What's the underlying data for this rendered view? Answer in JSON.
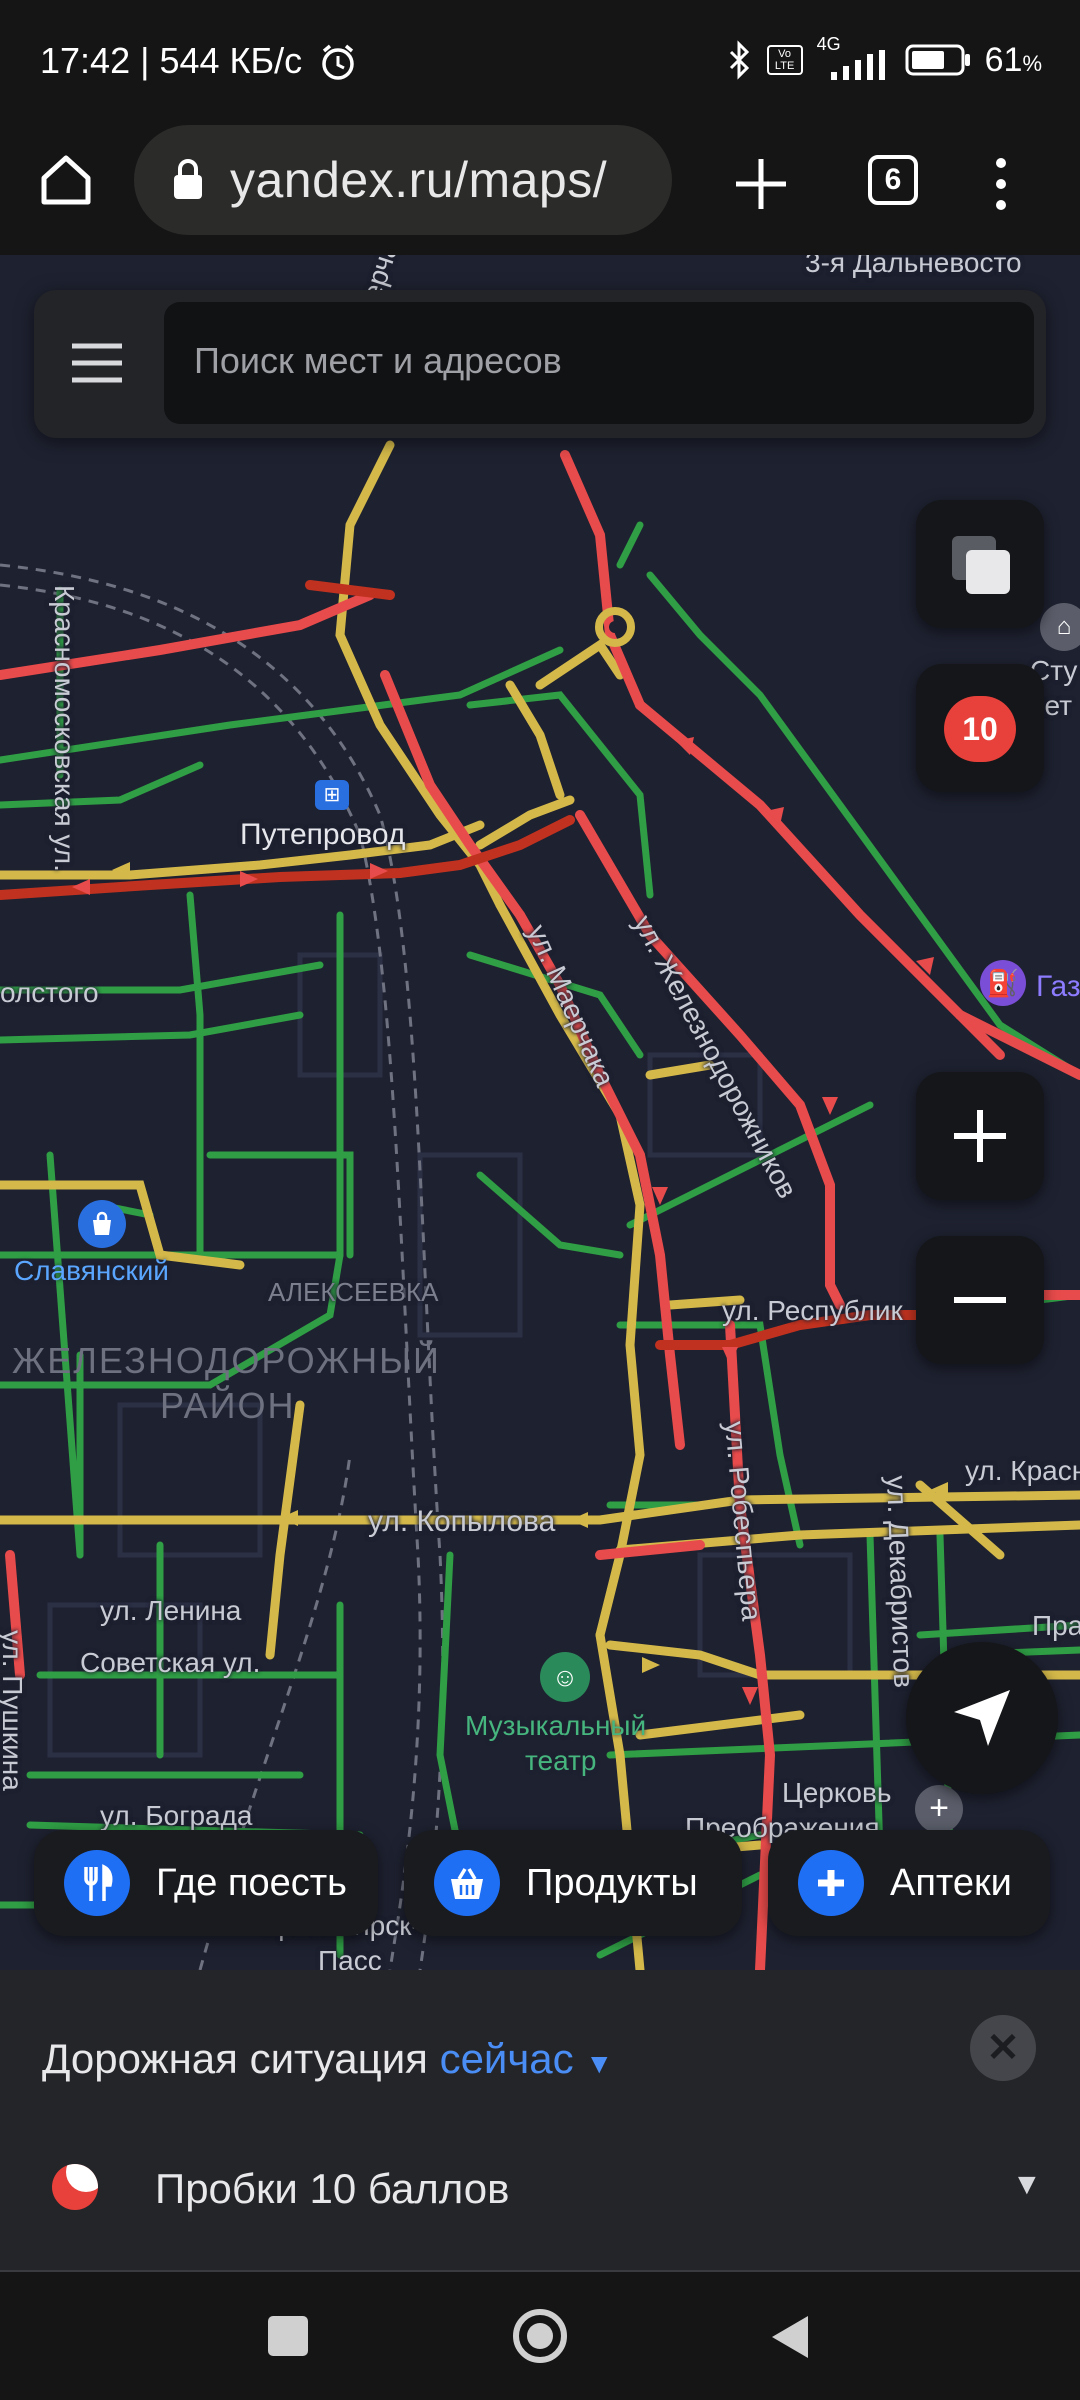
{
  "status_bar": {
    "time": "17:42 | 544 КБ/с",
    "signal_type": "4G",
    "volte": "Vo LTE",
    "battery": "61",
    "battery_unit": "%",
    "icons": [
      "alarm-icon",
      "bluetooth-icon",
      "signal-icon",
      "battery-icon"
    ]
  },
  "browser": {
    "url": "yandex.ru/maps/",
    "tab_count": "6",
    "icons": [
      "home-icon",
      "lock-icon",
      "new-tab-icon",
      "tabs-icon",
      "more-icon"
    ]
  },
  "search": {
    "placeholder": "Поиск мест и адресов"
  },
  "map_controls": {
    "traffic_score": "10"
  },
  "map_labels": {
    "street_top": "3-я Дальневосто",
    "maerchaka_1": "ул. Маерчака",
    "maerchaka_2": "ул. Маерчака",
    "krasnomoskovskaya": "Красномосковская ул.",
    "puteprovod": "Путепровод",
    "zheleznodorozhnikov": "ул. Железнодорожников",
    "tolstogo": "олстого",
    "gas_station": "Газ",
    "slavyansky": "Славянский",
    "alekseevka": "АЛЕКСЕЕВКА",
    "district_1": "ЖЕЛЕЗНОДОРОЖНЫЙ",
    "district_2": "РАЙОН",
    "respubliki": "ул. Республик",
    "robespera": "ул. Робеспьера",
    "kopylova": "ул. Копылова",
    "krasn": "ул. Красн",
    "dekabristov": "ул. Декабристов",
    "lenina": "ул. Ленина",
    "sovetskaya": "Советская ул.",
    "pushkina": "ул. Пушкина",
    "music_theatre_1": "Музыкальный",
    "music_theatre_2": "театр",
    "bograda": "ул. Бограда",
    "church_1": "Церковь",
    "church_2": "Преображения",
    "krasnoyarsk_1": "Красноярск-",
    "krasnoyarsk_2": "Пасс",
    "pravi": "Прави",
    "sturt": "Сту",
    "bet": "вет"
  },
  "chips": [
    {
      "label": "Где поесть",
      "icon": "fork-knife-icon"
    },
    {
      "label": "Продукты",
      "icon": "basket-icon"
    },
    {
      "label": "Аптеки",
      "icon": "pharmacy-cross-icon"
    }
  ],
  "traffic_panel": {
    "title": "Дорожная ситуация",
    "time_selector": "сейчас",
    "jam_label": "Пробки 10 баллов"
  },
  "colors": {
    "jam_red": "#e84b4b",
    "jam_dark_red": "#c0321f",
    "slow_yellow": "#d4b94a",
    "free_green": "#2f9e45",
    "accent_blue": "#4a8ef5",
    "map_bg": "#1e2130"
  }
}
